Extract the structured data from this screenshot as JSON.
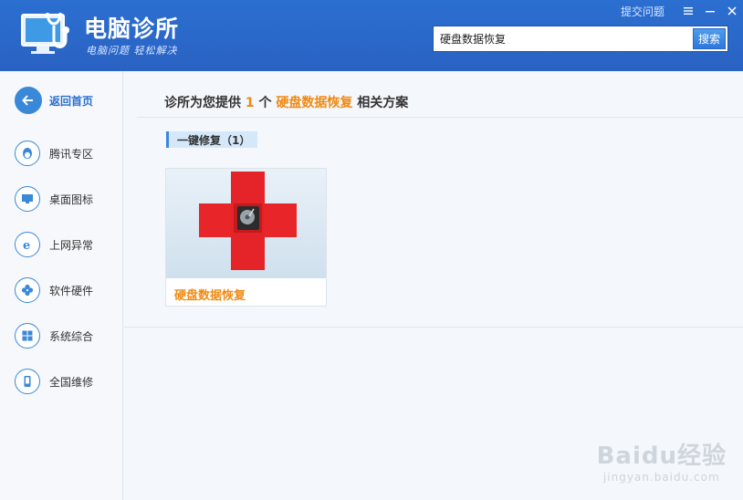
{
  "header": {
    "app_title": "电脑诊所",
    "slogan": "电脑问题 轻松解决",
    "feedback_link": "提交问题",
    "search": {
      "value": "硬盘数据恢复",
      "placeholder": "",
      "button_label": "搜索"
    },
    "window_controls": [
      "menu-icon",
      "minimize-icon",
      "close-icon"
    ]
  },
  "sidebar": {
    "items": [
      {
        "label": "返回首页",
        "icon": "back-arrow-icon"
      },
      {
        "label": "腾讯专区",
        "icon": "qq-penguin-icon"
      },
      {
        "label": "桌面图标",
        "icon": "monitor-icon"
      },
      {
        "label": "上网异常",
        "icon": "ie-browser-icon"
      },
      {
        "label": "软件硬件",
        "icon": "puzzle-icon"
      },
      {
        "label": "系统综合",
        "icon": "windows-icon"
      },
      {
        "label": "全国维修",
        "icon": "phone-icon"
      }
    ]
  },
  "main": {
    "result": {
      "prefix": "诊所为您提供",
      "count": "1",
      "unit": "个",
      "keyword": "硬盘数据恢复",
      "suffix": "相关方案"
    },
    "category": {
      "label": "一键修复（1）"
    },
    "cards": [
      {
        "title": "硬盘数据恢复",
        "icon": "hard-disk-repair-icon"
      }
    ]
  },
  "watermark": {
    "main": "Baidu经验",
    "sub": "jingyan.baidu.com"
  },
  "colors": {
    "header_blue": "#2b6fd1",
    "accent_orange": "#f08a13",
    "nav_blue": "#3a88d8",
    "repair_red": "#e8262a"
  }
}
